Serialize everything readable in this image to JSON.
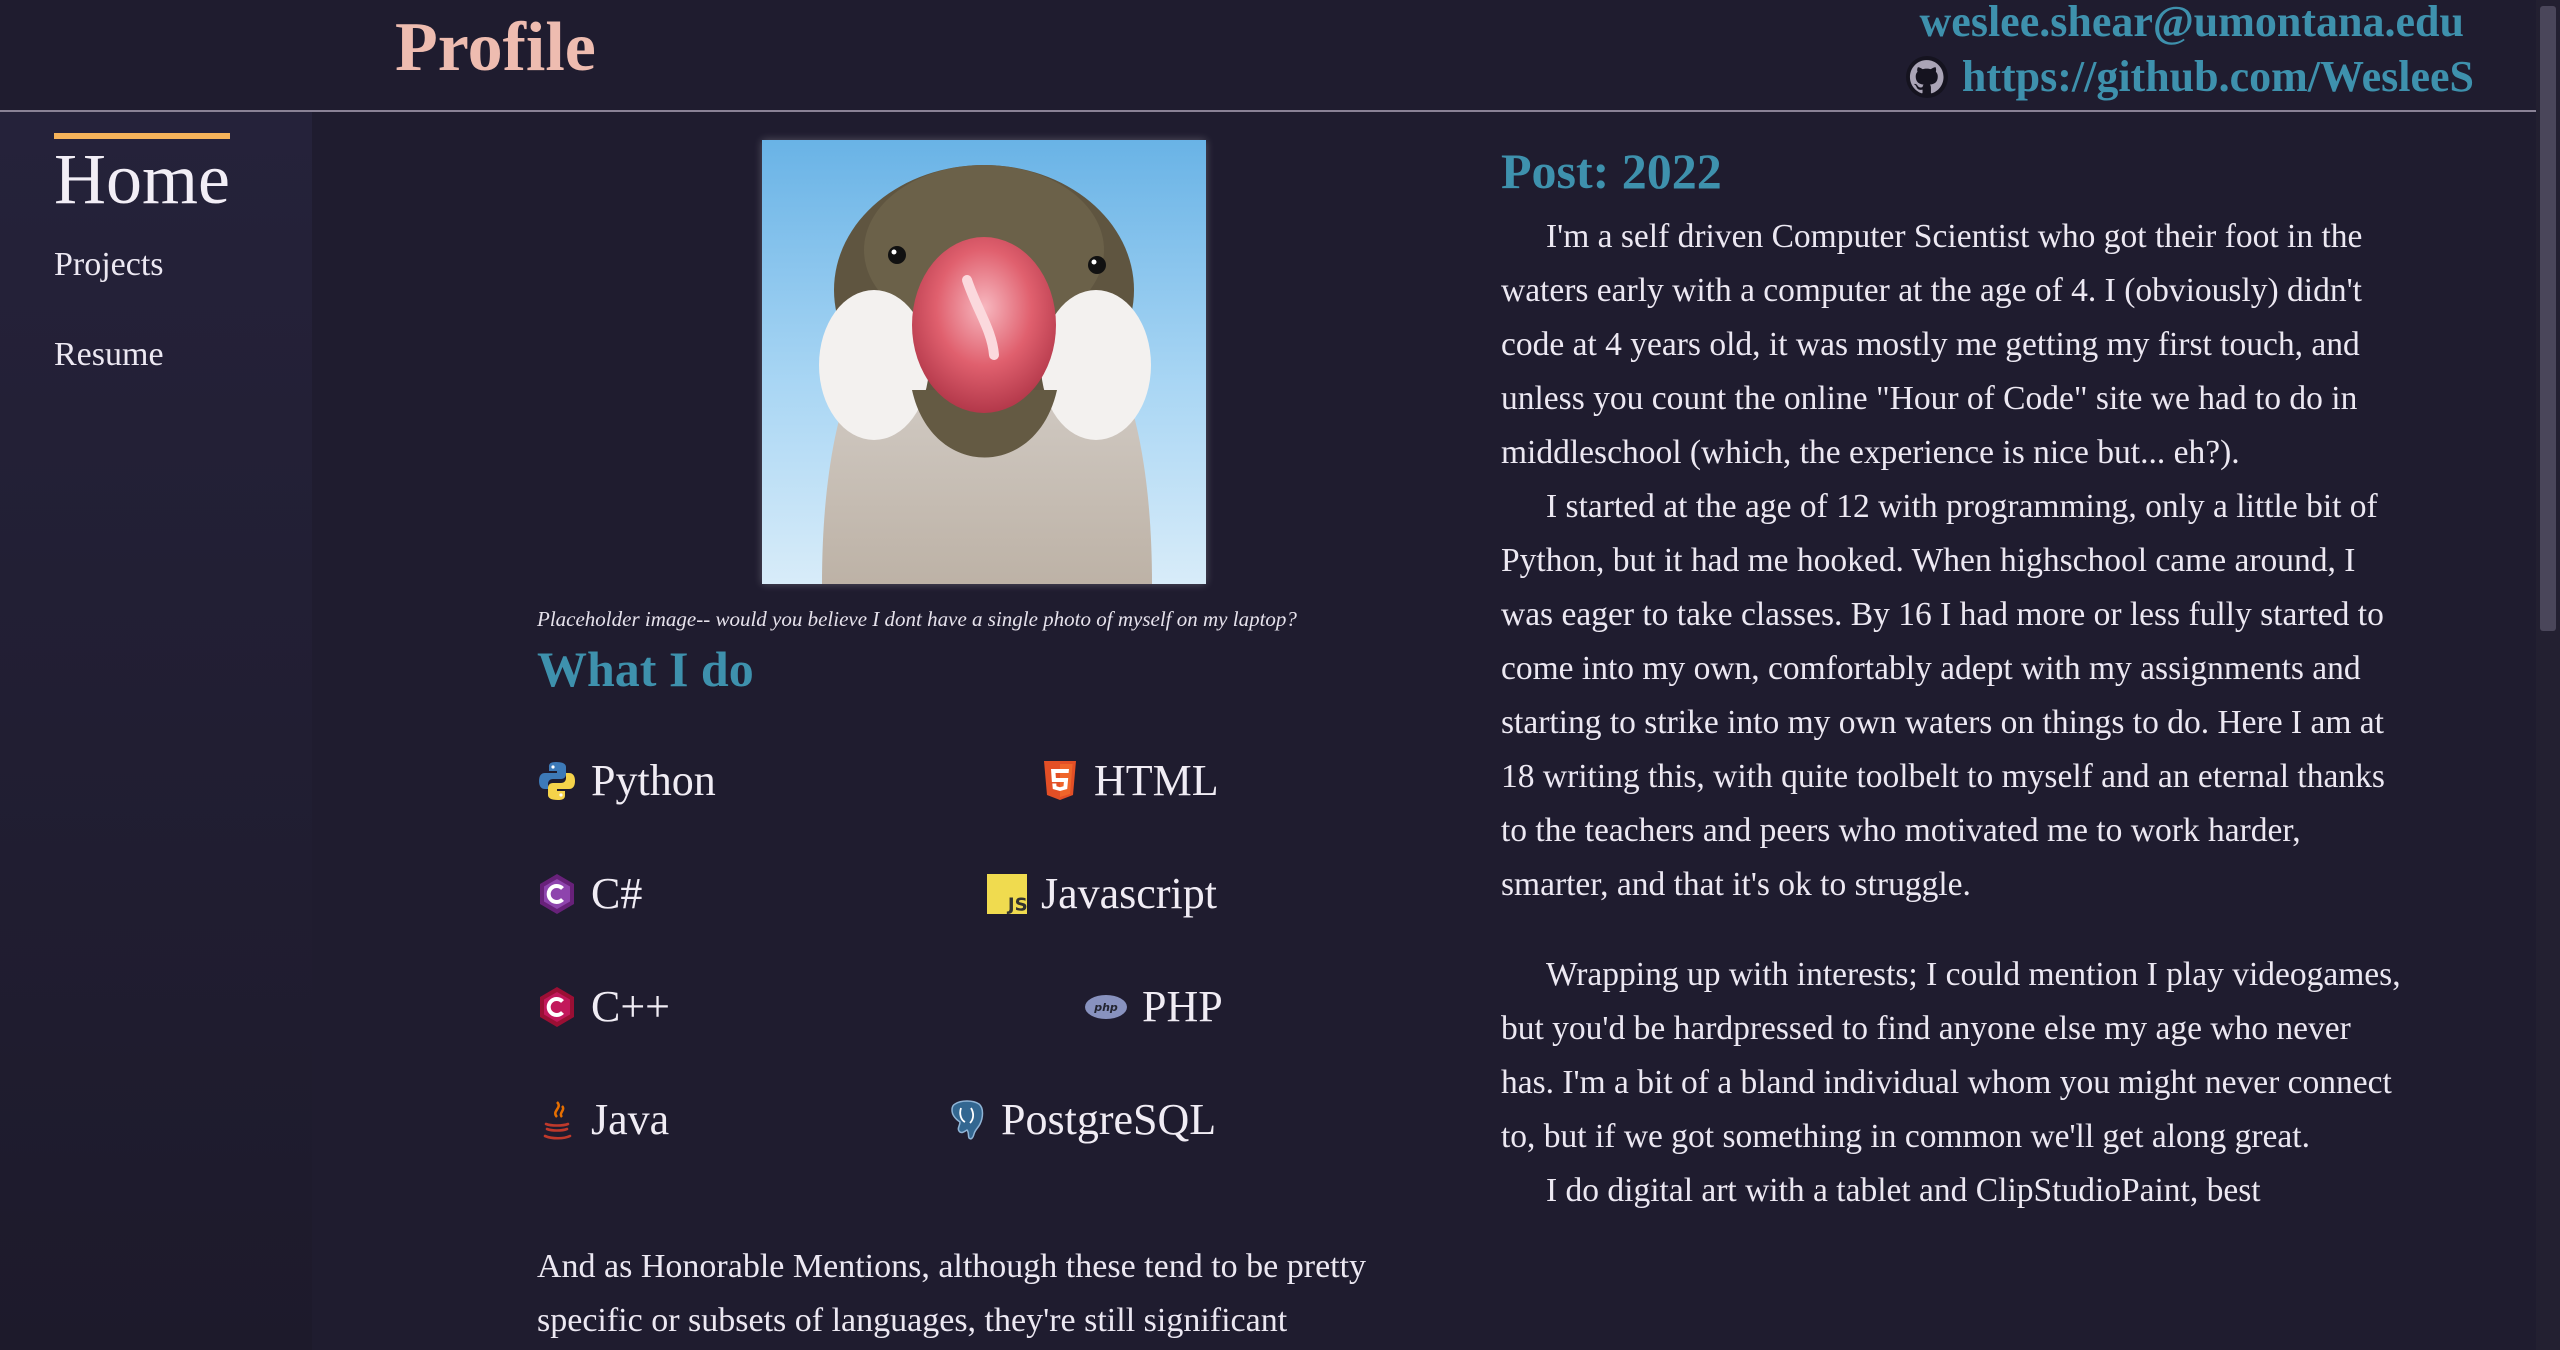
{
  "header": {
    "title": "Profile",
    "email": "weslee.shear@umontana.edu",
    "github": "https://github.com/WesleeS"
  },
  "sidebar": {
    "items": [
      {
        "label": "Home",
        "active": true
      },
      {
        "label": "Projects"
      },
      {
        "label": "Resume"
      }
    ],
    "accent_color": "#f6b35a"
  },
  "profile": {
    "caption": "Placeholder image-- would you believe I dont have a single photo of myself on my laptop?",
    "section_title": "What I do",
    "skills": [
      {
        "label": "Python",
        "icon": "python-icon"
      },
      {
        "label": "HTML",
        "icon": "html5-icon"
      },
      {
        "label": "C#",
        "icon": "csharp-icon"
      },
      {
        "label": "Javascript",
        "icon": "javascript-icon"
      },
      {
        "label": "C++",
        "icon": "cplusplus-icon"
      },
      {
        "label": "PHP",
        "icon": "php-icon"
      },
      {
        "label": "Java",
        "icon": "java-icon"
      },
      {
        "label": "PostgreSQL",
        "icon": "postgresql-icon"
      }
    ],
    "honorable_text": "And as Honorable Mentions, although these tend to be pretty specific or subsets of languages, they're still significant"
  },
  "post": {
    "title": "Post: 2022",
    "paragraphs": [
      "I'm a self driven Computer Scientist who got their foot in the waters early with a computer at the age of 4. I (obviously) didn't code at 4 years old, it was mostly me getting my first touch, and unless you count the online \"Hour of Code\" site we had to do in middleschool (which, the experience is nice but... eh?).",
      "I started at the age of 12 with programming, only a little bit of Python, but it had me hooked. When highschool came around, I was eager to take classes. By 16 I had more or less fully started to come into my own, comfortably adept with my assignments and starting to strike into my own waters on things to do. Here I am at 18 writing this, with quite toolbelt to myself and an eternal thanks to the teachers and peers who motivated me to work harder, smarter, and that it's ok to struggle.",
      "Wrapping up with interests; I could mention I play videogames, but you'd be hardpressed to find anyone else my age who never has. I'm a bit of a bland individual whom you might never connect to, but if we got something in common we'll get along great.",
      "I do digital art with a tablet and ClipStudioPaint, best"
    ]
  },
  "colors": {
    "background": "#1f1c2f",
    "heading_accent": "#3e91ad",
    "title_pink": "#eebcb0"
  }
}
